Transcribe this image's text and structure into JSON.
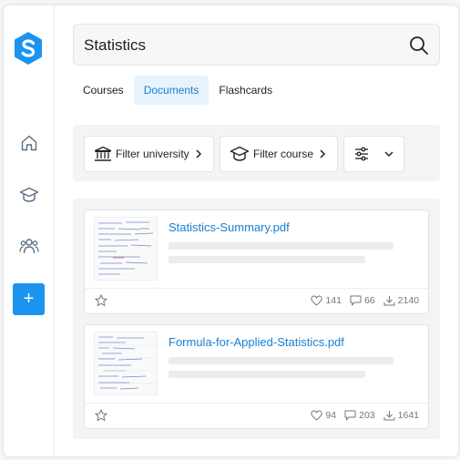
{
  "search": {
    "query": "Statistics"
  },
  "tabs": [
    {
      "label": "Courses",
      "active": false
    },
    {
      "label": "Documents",
      "active": true
    },
    {
      "label": "Flashcards",
      "active": false
    }
  ],
  "filters": {
    "university": "Filter university",
    "course": "Filter course"
  },
  "documents": [
    {
      "title": "Statistics-Summary.pdf",
      "likes": "141",
      "comments": "66",
      "downloads": "2140"
    },
    {
      "title": "Formula-for-Applied-Statistics.pdf",
      "likes": "94",
      "comments": "203",
      "downloads": "1641"
    }
  ],
  "colors": {
    "accent": "#1a94f0",
    "link": "#1a7fd0",
    "tab_active_bg": "#e7f3fd"
  },
  "icons": {
    "sidebar": [
      "home-icon",
      "graduation-cap-icon",
      "people-icon",
      "plus-icon"
    ],
    "filters": [
      "university-building-icon",
      "graduation-cap-icon",
      "sliders-icon",
      "chevron-down-icon"
    ]
  }
}
